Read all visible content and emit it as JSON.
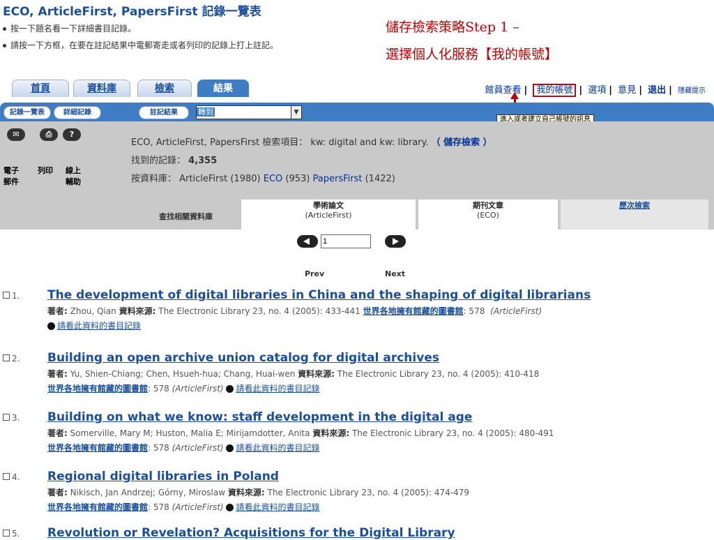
{
  "page_title": "ECO, ArticleFirst, PapersFirst 記錄一覽表",
  "instructions": [
    "按一下題名看一下詳細書目記錄。",
    "請按一下方框，在要在註記結果中電郵寄走或者列印的記錄上打上註記。"
  ],
  "annotation": {
    "line1": "儲存檢索策略Step 1 –",
    "line2": "選擇個人化服務【我的帳號】"
  },
  "tabs": [
    "首頁",
    "資料庫",
    "檢索",
    "結果"
  ],
  "toplinks": {
    "staff": "館員查看",
    "myaccount": "我的帳號",
    "options": "選項",
    "comments": "意見",
    "exit": "退出",
    "hide": "隱藏提示"
  },
  "subnav": {
    "list": "記錄一覽表",
    "detail": "詳細記錄",
    "marked": "註記結果",
    "goto": "轉到"
  },
  "tooltip": "進入或者建立自己帳號的訊息",
  "toolbar": {
    "email": "電子郵件",
    "print": "列印",
    "help": "線上輔助"
  },
  "search_info": {
    "line1_prefix": "ECO, ArticleFirst, PapersFirst 檢索項目： kw: digital and kw: library.",
    "save_link": "（ 儲存檢索 ）",
    "found_label": "找到的記錄：",
    "found_value": "4,355",
    "by_db_label": "按資料庫：",
    "db1": "ArticleFirst (1980)",
    "db2": "ECO",
    "db2_count": "(953)",
    "db3": "PapersFirst",
    "db3_count": "(1422)"
  },
  "subtabs": {
    "related": "查找相關資料庫",
    "academic": "學術論文",
    "academic_src": "(ArticleFirst)",
    "journal": "期刊文章",
    "journal_src": "(ECO)",
    "history": "歷次檢索"
  },
  "pager": {
    "page": "1",
    "prev": "Prev",
    "next": "Next"
  },
  "labels": {
    "author": "著者:",
    "source": "資料來源:",
    "libs": "世界各地擁有館藏的圖書館",
    "view": "請看此資料的書目記錄"
  },
  "results": [
    {
      "num": "1.",
      "title": "The development of digital libraries in China and the shaping of digital librarians",
      "author": "Zhou, Qian",
      "source": "The Electronic Library 23, no. 4 (2005): 433-441",
      "libcount": ": 578",
      "db": "(ArticleFirst)"
    },
    {
      "num": "2.",
      "title": "Building an open archive union catalog for digital archives",
      "author": "Yu, Shien-Chiang; Chen, Hsueh-hua; Chang, Huai-wen",
      "source": "The Electronic Library 23, no. 4 (2005): 410-418",
      "libcount": ": 578",
      "db": "(ArticleFirst)"
    },
    {
      "num": "3.",
      "title": "Building on what we know: staff development in the digital age",
      "author": "Somerville, Mary M; Huston, Malia E; Mirijamdotter, Anita",
      "source": "The Electronic Library 23, no. 4 (2005): 480-491",
      "libcount": ": 578",
      "db": "(ArticleFirst)"
    },
    {
      "num": "4.",
      "title": "Regional digital libraries in Poland",
      "author": "Nikisch, Jan Andrzej; Górny, Miroslaw",
      "source": "The Electronic Library 23, no. 4 (2005): 474-479",
      "libcount": ": 578",
      "db": "(ArticleFirst)"
    },
    {
      "num": "5.",
      "title": "Revolution or Revelation? Acquisitions for the Digital Library"
    }
  ]
}
